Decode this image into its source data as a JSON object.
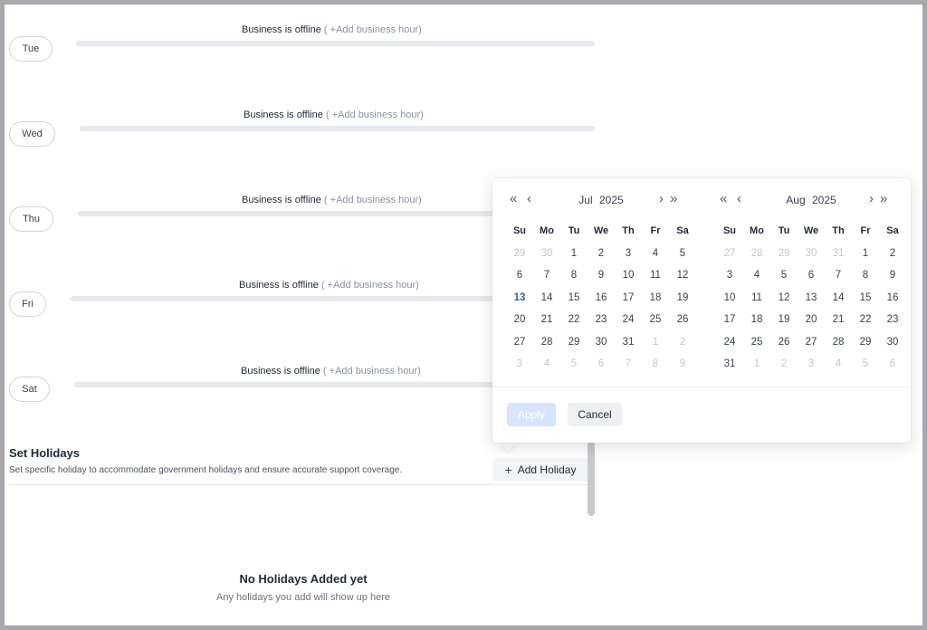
{
  "days": [
    {
      "label": "Tue",
      "status": "Business is offline",
      "add_link": "( +Add business hour)"
    },
    {
      "label": "Wed",
      "status": "Business is offline",
      "add_link": "( +Add business hour)"
    },
    {
      "label": "Thu",
      "status": "Business is offline",
      "add_link": "( +Add business hour)"
    },
    {
      "label": "Fri",
      "status": "Business is offline",
      "add_link": "( +Add business hour)"
    },
    {
      "label": "Sat",
      "status": "Business is offline",
      "add_link": "( +Add business hour)"
    }
  ],
  "holidays": {
    "title": "Set Holidays",
    "description": "Set specific holiday to accommodate government holidays and ensure accurate support coverage.",
    "add_button": "Add Holiday",
    "empty_title": "No Holidays Added yet",
    "empty_subtitle": "Any holidays you add will show up here"
  },
  "datepicker": {
    "weekdays": [
      "Su",
      "Mo",
      "Tu",
      "We",
      "Th",
      "Fr",
      "Sa"
    ],
    "nav": {
      "prev_year": "«",
      "prev_month": "‹",
      "next_month": "›",
      "next_year": "»"
    },
    "left": {
      "month": "Jul",
      "year": "2025",
      "weeks": [
        [
          "29",
          "30",
          "1",
          "2",
          "3",
          "4",
          "5"
        ],
        [
          "6",
          "7",
          "8",
          "9",
          "10",
          "11",
          "12"
        ],
        [
          "13",
          "14",
          "15",
          "16",
          "17",
          "18",
          "19"
        ],
        [
          "20",
          "21",
          "22",
          "23",
          "24",
          "25",
          "26"
        ],
        [
          "27",
          "28",
          "29",
          "30",
          "31",
          "1",
          "2"
        ],
        [
          "3",
          "4",
          "5",
          "6",
          "7",
          "8",
          "9"
        ]
      ],
      "muted": [
        [
          0,
          0
        ],
        [
          0,
          1
        ],
        [
          4,
          5
        ],
        [
          4,
          6
        ],
        [
          5,
          0
        ],
        [
          5,
          1
        ],
        [
          5,
          2
        ],
        [
          5,
          3
        ],
        [
          5,
          4
        ],
        [
          5,
          5
        ],
        [
          5,
          6
        ]
      ],
      "today": [
        2,
        0
      ]
    },
    "right": {
      "month": "Aug",
      "year": "2025",
      "weeks": [
        [
          "27",
          "28",
          "29",
          "30",
          "31",
          "1",
          "2"
        ],
        [
          "3",
          "4",
          "5",
          "6",
          "7",
          "8",
          "9"
        ],
        [
          "10",
          "11",
          "12",
          "13",
          "14",
          "15",
          "16"
        ],
        [
          "17",
          "18",
          "19",
          "20",
          "21",
          "22",
          "23"
        ],
        [
          "24",
          "25",
          "26",
          "27",
          "28",
          "29",
          "30"
        ],
        [
          "31",
          "1",
          "2",
          "3",
          "4",
          "5",
          "6"
        ]
      ],
      "muted": [
        [
          0,
          0
        ],
        [
          0,
          1
        ],
        [
          0,
          2
        ],
        [
          0,
          3
        ],
        [
          0,
          4
        ],
        [
          5,
          1
        ],
        [
          5,
          2
        ],
        [
          5,
          3
        ],
        [
          5,
          4
        ],
        [
          5,
          5
        ],
        [
          5,
          6
        ]
      ],
      "today": null
    },
    "apply_label": "Apply",
    "cancel_label": "Cancel"
  }
}
